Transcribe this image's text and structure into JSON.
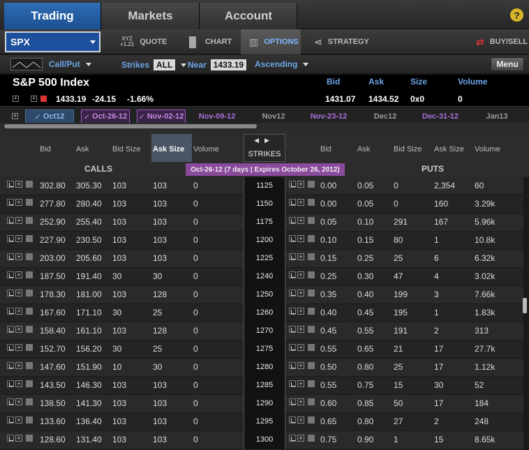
{
  "nav": {
    "tabs": [
      "Trading",
      "Markets",
      "Account"
    ],
    "help": "?"
  },
  "toolbar": {
    "symbol": "SPX",
    "quote_prefix": "XYZ",
    "quote_prefix_sub": "+1.21",
    "quote": "QUOTE",
    "chart": "CHART",
    "options": "OPTIONS",
    "strategy": "STRATEGY",
    "buysell": "BUY/SELL"
  },
  "filters": {
    "callput": "Call/Put",
    "strikes_label": "Strikes",
    "strikes_value": "ALL",
    "near_label": "Near",
    "near_value": "1433.19",
    "order": "Ascending",
    "menu": "Menu"
  },
  "quote": {
    "name": "S&P 500 Index",
    "last": "1433.19",
    "change": "-24.15",
    "pct": "-1.66%",
    "headers": {
      "bid": "Bid",
      "ask": "Ask",
      "size": "Size",
      "volume": "Volume"
    },
    "bid": "1431.07",
    "ask": "1434.52",
    "size": "0x0",
    "volume": "0"
  },
  "expirations": [
    "Oct12",
    "Oct-26-12",
    "Nov-02-12",
    "Nov-09-12",
    "Nov12",
    "Nov-23-12",
    "Dec12",
    "Dec-31-12",
    "Jan13"
  ],
  "chain": {
    "call_headers": [
      "Bid",
      "Ask",
      "Bid Size",
      "Ask Size",
      "Volume"
    ],
    "strike_header": "STRIKES",
    "put_headers": [
      "Bid",
      "Ask",
      "Bid Size",
      "Ask Size",
      "Volume"
    ],
    "calls_label": "CALLS",
    "puts_label": "PUTS",
    "exp_banner": "Oct-26-12   (7 days | Expires October 26, 2012)"
  },
  "rows": [
    {
      "c": [
        "302.80",
        "305.30",
        "103",
        "103",
        "0"
      ],
      "k": "1125",
      "p": [
        "0.00",
        "0.05",
        "0",
        "2,354",
        "60"
      ]
    },
    {
      "c": [
        "277.80",
        "280.40",
        "103",
        "103",
        "0"
      ],
      "k": "1150",
      "p": [
        "0.00",
        "0.05",
        "0",
        "160",
        "3.29k"
      ]
    },
    {
      "c": [
        "252.90",
        "255.40",
        "103",
        "103",
        "0"
      ],
      "k": "1175",
      "p": [
        "0.05",
        "0.10",
        "291",
        "167",
        "5.96k"
      ]
    },
    {
      "c": [
        "227.90",
        "230.50",
        "103",
        "103",
        "0"
      ],
      "k": "1200",
      "p": [
        "0.10",
        "0.15",
        "80",
        "1",
        "10.8k"
      ]
    },
    {
      "c": [
        "203.00",
        "205.60",
        "103",
        "103",
        "0"
      ],
      "k": "1225",
      "p": [
        "0.15",
        "0.25",
        "25",
        "6",
        "6.32k"
      ]
    },
    {
      "c": [
        "187.50",
        "191.40",
        "30",
        "30",
        "0"
      ],
      "k": "1240",
      "p": [
        "0.25",
        "0.30",
        "47",
        "4",
        "3.02k"
      ]
    },
    {
      "c": [
        "178.30",
        "181.00",
        "103",
        "128",
        "0"
      ],
      "k": "1250",
      "p": [
        "0.35",
        "0.40",
        "199",
        "3",
        "7.66k"
      ]
    },
    {
      "c": [
        "167.60",
        "171.10",
        "30",
        "25",
        "0"
      ],
      "k": "1260",
      "p": [
        "0.40",
        "0.45",
        "195",
        "1",
        "1.83k"
      ]
    },
    {
      "c": [
        "158.40",
        "161.10",
        "103",
        "128",
        "0"
      ],
      "k": "1270",
      "p": [
        "0.45",
        "0.55",
        "191",
        "2",
        "313"
      ]
    },
    {
      "c": [
        "152.70",
        "156.20",
        "30",
        "25",
        "0"
      ],
      "k": "1275",
      "p": [
        "0.55",
        "0.65",
        "21",
        "17",
        "27.7k"
      ]
    },
    {
      "c": [
        "147.60",
        "151.90",
        "10",
        "30",
        "0"
      ],
      "k": "1280",
      "p": [
        "0.50",
        "0.80",
        "25",
        "17",
        "1.12k"
      ]
    },
    {
      "c": [
        "143.50",
        "146.30",
        "103",
        "103",
        "0"
      ],
      "k": "1285",
      "p": [
        "0.55",
        "0.75",
        "15",
        "30",
        "52"
      ]
    },
    {
      "c": [
        "138.50",
        "141.30",
        "103",
        "103",
        "0"
      ],
      "k": "1290",
      "p": [
        "0.60",
        "0.85",
        "50",
        "17",
        "184"
      ]
    },
    {
      "c": [
        "133.60",
        "136.40",
        "103",
        "103",
        "0"
      ],
      "k": "1295",
      "p": [
        "0.65",
        "0.80",
        "27",
        "2",
        "248"
      ]
    },
    {
      "c": [
        "128.60",
        "131.40",
        "103",
        "103",
        "0"
      ],
      "k": "1300",
      "p": [
        "0.75",
        "0.90",
        "1",
        "15",
        "8.65k"
      ]
    }
  ]
}
